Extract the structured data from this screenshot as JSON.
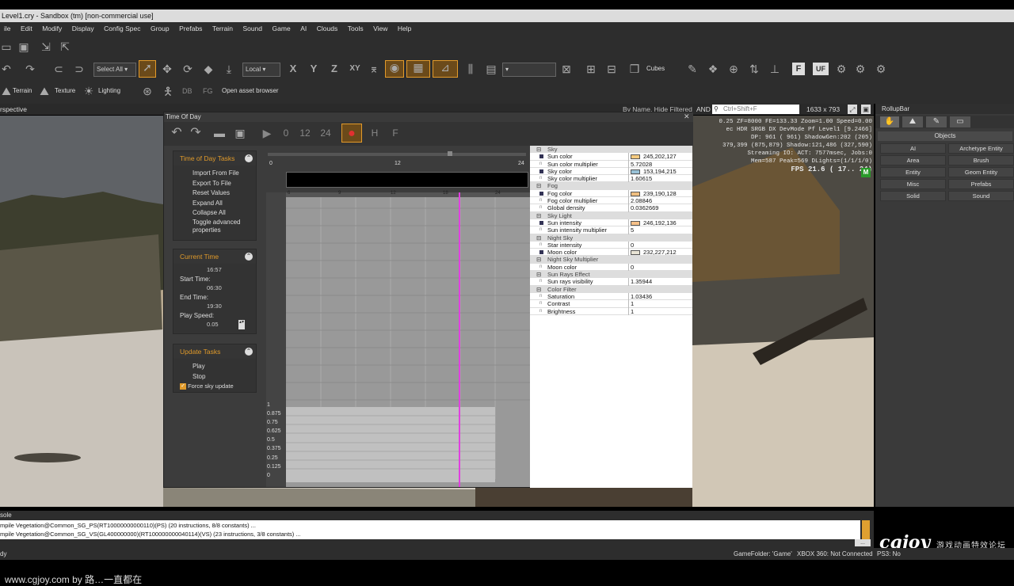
{
  "window_title": "Level1.cry - Sandbox (tm) [non-commercial use]",
  "menu": [
    "ile",
    "Edit",
    "Modify",
    "Display",
    "Config Spec",
    "Group",
    "Prefabs",
    "Terrain",
    "Sound",
    "Game",
    "AI",
    "Clouds",
    "Tools",
    "View",
    "Help"
  ],
  "toolbar": {
    "select_all": "Select All",
    "coord_system": "Local",
    "axes": [
      "X",
      "Y",
      "Z",
      "XY"
    ],
    "cubes": "Cubes",
    "terrain": "Terrain",
    "texture": "Texture",
    "lighting": "Lighting",
    "db": "DB",
    "fg": "FG",
    "asset_browser": "Open asset browser",
    "f_btn": "F",
    "uf_btn": "UF"
  },
  "viewport": {
    "name": "rspective",
    "filter": "By Name, Hide Filtered",
    "and": "AND",
    "search_placeholder": "Ctrl+Shift+F",
    "resolution": "1633 x 793",
    "hud": [
      "0.25 ZF=8000 FE=133.33 Zoom=1.00 Speed=0.00",
      "ec HDR SRGB DX DevMode Pf Level1 [9.2466]",
      "DP: 961 ( 961) ShadowGen:202 (205)",
      "379,399 (875,879) Shadow:121,486 (327,590)",
      "Streaming IO: ACT: 7577msec, Jobs:0",
      "Mem=587 Peak=569 DLights=(1/1/1/0)"
    ],
    "fps": "FPS  21.6 ( 17.. 24)",
    "m_badge": "M"
  },
  "tod": {
    "title": "Time Of Day",
    "toolbar_labels": [
      "0",
      "12",
      "24",
      "H",
      "F"
    ],
    "tasks_header": "Time of Day Tasks",
    "tasks": [
      "Import From File",
      "Export To File",
      "Reset Values",
      "Expand All",
      "Collapse All",
      "Toggle advanced properties"
    ],
    "current_time_header": "Current Time",
    "current_time": "16:57",
    "start_label": "Start Time:",
    "start_time": "06:30",
    "end_label": "End Time:",
    "end_time": "19:30",
    "speed_label": "Play Speed:",
    "speed": "0.05",
    "update_header": "Update Tasks",
    "play": "Play",
    "stop": "Stop",
    "force": "Force sky update",
    "ruler": [
      "0",
      "12",
      "24"
    ],
    "graph_ticks": [
      "6",
      "9",
      "12",
      "18",
      "24"
    ],
    "y_ticks": [
      "1",
      "0.875",
      "0.75",
      "0.625",
      "0.5",
      "0.375",
      "0.25",
      "0.125",
      "0"
    ],
    "current_time_fraction": 0.707
  },
  "props": [
    {
      "cat": "Sky"
    },
    {
      "name": "Sun color",
      "value": "245,202,127",
      "swatch": "#f5ca7f"
    },
    {
      "name": "Sun color multiplier",
      "value": "5.72028"
    },
    {
      "name": "Sky color",
      "value": "153,194,215",
      "swatch": "#99c2d7"
    },
    {
      "name": "Sky color multiplier",
      "value": "1.60615"
    },
    {
      "cat": "Fog"
    },
    {
      "name": "Fog color",
      "value": "239,190,128",
      "swatch": "#efbe80"
    },
    {
      "name": "Fog color multiplier",
      "value": "2.08846"
    },
    {
      "name": "Global density",
      "value": "0.0362669"
    },
    {
      "cat": "Sky Light"
    },
    {
      "name": "Sun intensity",
      "value": "246,192,136",
      "swatch": "#f6c088"
    },
    {
      "name": "Sun intensity multiplier",
      "value": "5"
    },
    {
      "cat": "Night Sky"
    },
    {
      "name": "Star intensity",
      "value": "0"
    },
    {
      "name": "Moon color",
      "value": "232,227,212",
      "swatch": "#e8e3d4"
    },
    {
      "cat": "Night Sky Multiplier"
    },
    {
      "name": "Moon color",
      "value": "0"
    },
    {
      "cat": "Sun Rays Effect"
    },
    {
      "name": "Sun rays visibility",
      "value": "1.35944"
    },
    {
      "cat": "Color Filter"
    },
    {
      "name": "Saturation",
      "value": "1.03436"
    },
    {
      "name": "Contrast",
      "value": "1"
    },
    {
      "name": "Brightness",
      "value": "1"
    }
  ],
  "rollup": {
    "title": "RollupBar",
    "section": "Objects",
    "buttons": [
      "AI",
      "Archetype Entity",
      "Area",
      "Brush",
      "Entity",
      "Geom Entity",
      "Misc",
      "Prefabs",
      "Solid",
      "Sound"
    ]
  },
  "console": {
    "title": "sole",
    "lines": [
      "mpile Vegetation@Common_SG_PS(RT10000000000110)(PS) (20 instructions, 8/8 constants) ...",
      "mpile Vegetation@Common_SG_VS(GL400000000)(RT100000000040114)(VS) (23 instructions, 3/8 constants) ..."
    ]
  },
  "status": {
    "left": "dy",
    "gamefolder": "GameFolder: 'Game'",
    "xbox": "XBOX 360: Not Connected",
    "ps3": "PS3: No",
    "watermark_logo": "cgjoy",
    "watermark_text": "游戏动画特效论坛"
  },
  "footer": "www.cgjoy.com by 路…一直都在"
}
